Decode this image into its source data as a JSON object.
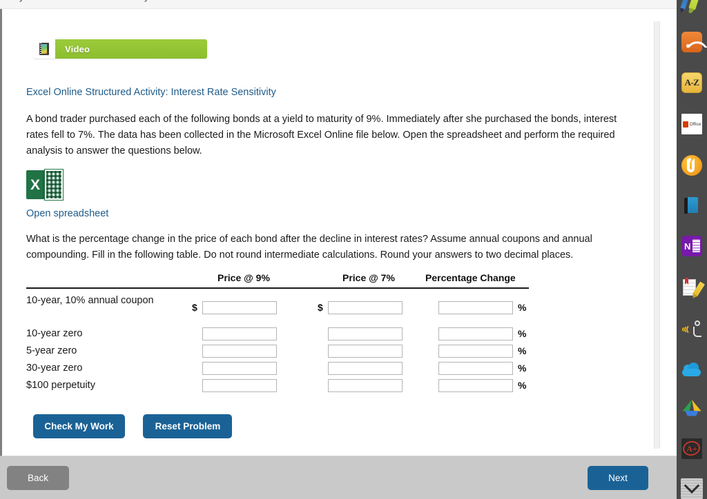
{
  "top_sliver": {
    "fragment_left": "y",
    "fragment_mid": "y"
  },
  "video_badge": {
    "label": "Video",
    "icon": "filmstrip-icon",
    "color": "#9ccb3b"
  },
  "activity": {
    "title": "Excel Online Structured Activity: Interest Rate Sensitivity",
    "link_color": "#1f5c8b"
  },
  "intro_paragraph": "A bond trader purchased each of the following bonds at a yield to maturity of 9%. Immediately after she purchased the bonds, interest rates fell to 7%. The data has been collected in the Microsoft Excel Online file below. Open the spreadsheet and perform the required analysis to answer the questions below.",
  "spreadsheet": {
    "icon": "excel-icon",
    "icon_letter": "X",
    "link_label": "Open spreadsheet"
  },
  "question_paragraph": "What is the percentage change in the price of each bond after the decline in interest rates? Assume annual coupons and annual compounding. Fill in the following table. Do not round intermediate calculations. Round your answers to two decimal places.",
  "table": {
    "headers": {
      "price_9": "Price @ 9%",
      "price_7": "Price @ 7%",
      "pct_change": "Percentage Change"
    },
    "dollar_sign": "$",
    "percent_sign": "%",
    "rows": [
      {
        "label": "10-year, 10% annual coupon",
        "price9": "",
        "price7": "",
        "pct": "",
        "show_dollar": true
      },
      {
        "label": "10-year zero",
        "price9": "",
        "price7": "",
        "pct": "",
        "show_dollar": false
      },
      {
        "label": "5-year zero",
        "price9": "",
        "price7": "",
        "pct": "",
        "show_dollar": false
      },
      {
        "label": "30-year zero",
        "price9": "",
        "price7": "",
        "pct": "",
        "show_dollar": false
      },
      {
        "label": "$100 perpetuity",
        "price9": "",
        "price7": "",
        "pct": "",
        "show_dollar": false
      }
    ]
  },
  "actions": {
    "check_label": "Check My Work",
    "reset_label": "Reset Problem",
    "primary_color": "#1a6296"
  },
  "bottom_bar": {
    "back_label": "Back",
    "next_label": "Next",
    "back_color": "#828282",
    "next_color": "#1a6296",
    "bar_color": "#c9c9c9"
  },
  "tool_rail": {
    "background": "#4a4a4a",
    "items": [
      {
        "name": "pen-highlighter-icon",
        "label": ""
      },
      {
        "name": "rss-feed-icon",
        "label": ""
      },
      {
        "name": "a-z-dictionary-icon",
        "label": "A-Z"
      },
      {
        "name": "office-icon",
        "label": "Office"
      },
      {
        "name": "reader-logo-icon",
        "label": ""
      },
      {
        "name": "blue-book-icon",
        "label": ""
      },
      {
        "name": "onenote-icon",
        "label": "N"
      },
      {
        "name": "notepad-pencil-icon",
        "label": ""
      },
      {
        "name": "read-aloud-icon",
        "label": ""
      },
      {
        "name": "onedrive-cloud-icon",
        "label": ""
      },
      {
        "name": "google-drive-icon",
        "label": ""
      },
      {
        "name": "grade-a-plus-icon",
        "label": "A+"
      },
      {
        "name": "chevron-down-icon",
        "label": ""
      }
    ]
  }
}
